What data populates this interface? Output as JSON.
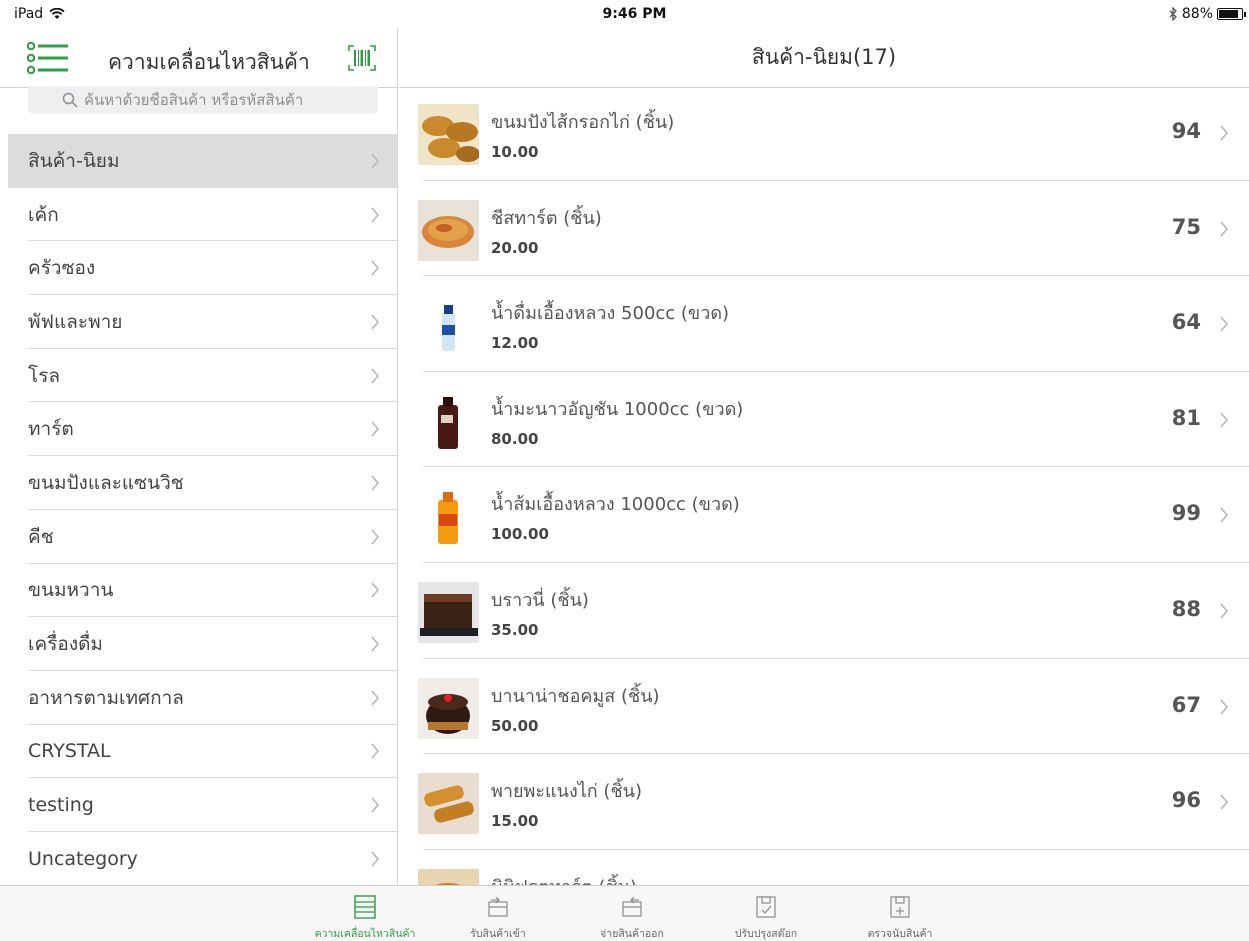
{
  "status_bar": {
    "device": "iPad",
    "time": "9:46 PM",
    "battery": "88%",
    "battery_level": 0.88
  },
  "left_panel": {
    "title": "ความเคลื่อนไหวสินค้า",
    "search_placeholder": "ค้นหาด้วยชื่อสินค้า หรือรหัสสินค้า",
    "categories": [
      "สินค้า-นิยม",
      "เค้ก",
      "ครัวซอง",
      "พัฟและพาย",
      "โรล",
      "ทาร์ต",
      "ขนมปังและแซนวิช",
      "คีช",
      "ขนมหวาน",
      "เครื่องดื่ม",
      "อาหารตามเทศกาล",
      "CRYSTAL",
      "testing",
      "Uncategory"
    ],
    "selected_index": 0
  },
  "right_panel": {
    "title": "สินค้า-นิยม(17)",
    "products": [
      {
        "name": "ขนมปังไส้กรอกไก่ (ชิ้น)",
        "price": "10.00",
        "qty": "94",
        "thumb": "sausage-bread"
      },
      {
        "name": "ชีสทาร์ต (ชิ้น)",
        "price": "20.00",
        "qty": "75",
        "thumb": "cheese-tart"
      },
      {
        "name": "น้ำดื่มเอื้องหลวง 500cc (ขวด)",
        "price": "12.00",
        "qty": "64",
        "thumb": "water-bottle"
      },
      {
        "name": "น้ำมะนาวอัญชัน 1000cc (ขวด)",
        "price": "80.00",
        "qty": "81",
        "thumb": "dark-bottle"
      },
      {
        "name": "น้ำส้มเอื้องหลวง 1000cc (ขวด)",
        "price": "100.00",
        "qty": "99",
        "thumb": "orange-bottle"
      },
      {
        "name": "บราวนี่ (ชิ้น)",
        "price": "35.00",
        "qty": "88",
        "thumb": "brownie"
      },
      {
        "name": "บานาน่าชอคมูส (ชิ้น)",
        "price": "50.00",
        "qty": "67",
        "thumb": "choc-mousse"
      },
      {
        "name": "พายพะแนงไก่ (ชิ้น)",
        "price": "15.00",
        "qty": "96",
        "thumb": "panang-pie"
      },
      {
        "name": "มินิฟรุตทาร์ต (ชิ้น)",
        "price": "",
        "qty": "",
        "thumb": "mini-fruit-tart"
      }
    ]
  },
  "tab_bar": {
    "tabs": [
      {
        "label": "ความเคลื่อนไหวสินค้า",
        "icon": "list-icon",
        "active": true
      },
      {
        "label": "รับสินค้าเข้า",
        "icon": "receive-icon",
        "active": false
      },
      {
        "label": "จ่ายสินค้าออก",
        "icon": "dispatch-icon",
        "active": false
      },
      {
        "label": "ปรับปรุงสต๊อก",
        "icon": "adjust-stock-icon",
        "active": false
      },
      {
        "label": "ตรวจนับสินค้า",
        "icon": "count-stock-icon",
        "active": false
      }
    ]
  },
  "colors": {
    "accent": "#2e9e44",
    "selected_row": "#dcdcdc",
    "separator": "#dcdcdc"
  }
}
